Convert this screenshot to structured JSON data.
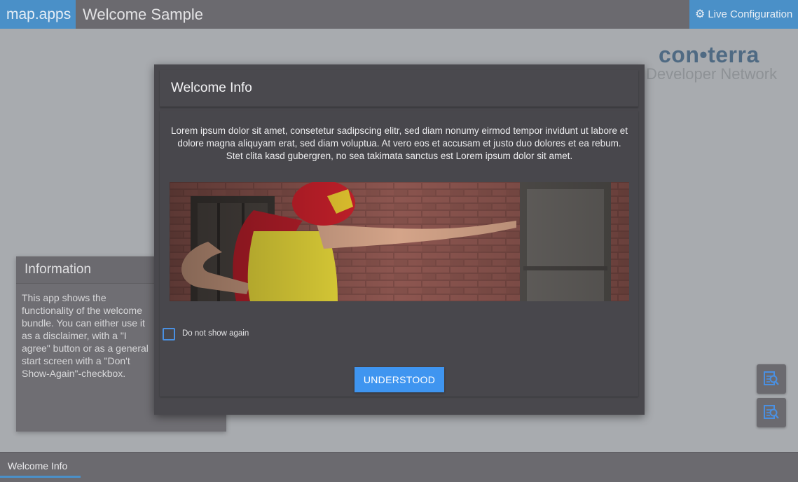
{
  "topbar": {
    "brand": "map.apps",
    "title": "Welcome Sample",
    "live_config_label": "Live Configuration",
    "live_config_icon": "gear-icon"
  },
  "logo": {
    "line1": "con•terra",
    "line2": "Developer Network"
  },
  "info_panel": {
    "title": "Information",
    "text": "This app shows the functionality of the welcome bundle. You can either use it as a disclaimer, with a \"I agree\" button or as a general start screen with a \"Don't Show-Again\"-checkbox."
  },
  "modal": {
    "title": "Welcome Info",
    "text": "Lorem ipsum dolor sit amet, consetetur sadipscing elitr, sed diam nonumy eirmod tempor invidunt ut labore et dolore magna aliquyam erat, sed diam voluptua. At vero eos et accusam et justo duo dolores et ea rebum. Stet clita kasd gubergren, no sea takimata sanctus est Lorem ipsum dolor sit amet.",
    "checkbox_label": "Do not show again",
    "checkbox_checked": false,
    "button_label": "UNDERSTOOD"
  },
  "side_buttons": [
    {
      "icon": "document-search-icon"
    },
    {
      "icon": "document-search-icon"
    }
  ],
  "bottombar": {
    "tab_label": "Welcome Info"
  },
  "colors": {
    "accent": "#4a90c8",
    "button": "#3f95f0",
    "panel": "#49484d"
  }
}
